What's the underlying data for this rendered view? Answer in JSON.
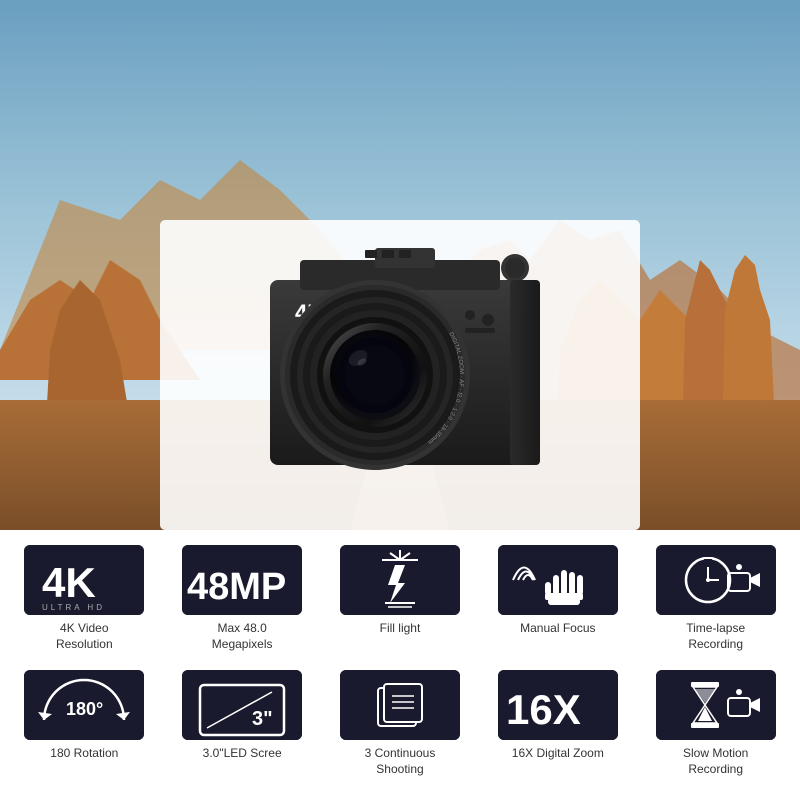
{
  "hero": {
    "alt": "Canyon landscape background"
  },
  "features": {
    "row1": [
      {
        "id": "4k",
        "badge_text": "4K",
        "badge_sub": "ULTRA HD",
        "label": "4K Video\nResolution",
        "icon_type": "text-4k"
      },
      {
        "id": "48mp",
        "badge_text": "48MP",
        "label": "Max 48.0\nMegapixels",
        "icon_type": "text-48mp"
      },
      {
        "id": "fill-light",
        "label": "Fill light",
        "icon_type": "fill-light"
      },
      {
        "id": "manual-focus",
        "label": "Manual Focus",
        "icon_type": "manual-focus"
      },
      {
        "id": "timelapse",
        "label": "Time-lapse\nRecording",
        "icon_type": "timelapse"
      }
    ],
    "row2": [
      {
        "id": "rotation",
        "badge_text": "180°",
        "label": "180 Rotation",
        "icon_type": "rotation"
      },
      {
        "id": "screen",
        "badge_text": "3\"",
        "label": "3.0\"LED Scree",
        "icon_type": "screen"
      },
      {
        "id": "continuous",
        "label": "3 Continuous\nShooting",
        "icon_type": "continuous"
      },
      {
        "id": "zoom",
        "badge_text": "16X",
        "label": "16X Digital Zoom",
        "icon_type": "zoom"
      },
      {
        "id": "slowmo",
        "label": "Slow Motion\nRecording",
        "icon_type": "slowmo"
      }
    ]
  }
}
